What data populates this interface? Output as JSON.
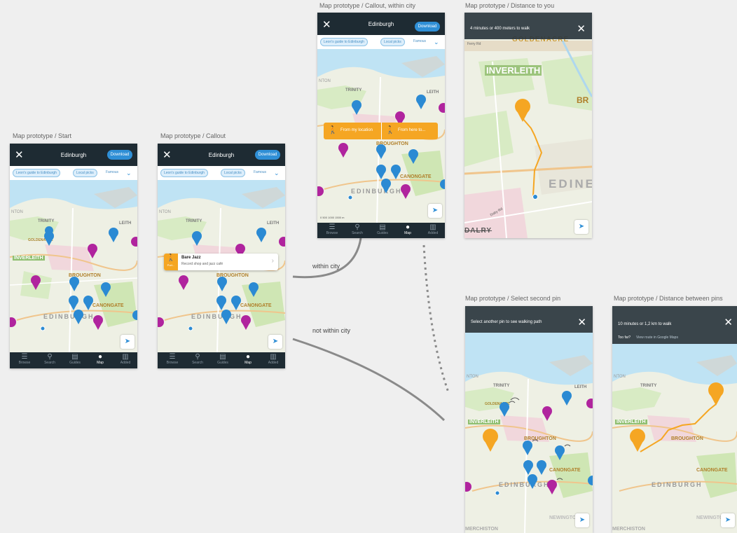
{
  "frames": {
    "start": {
      "label": "Map prototype / Start"
    },
    "callout": {
      "label": "Map prototype / Callout"
    },
    "callout_city": {
      "label": "Map prototype / Callout, within city"
    },
    "distance_you": {
      "label": "Map prototype / Distance to you"
    },
    "select_second": {
      "label": "Map prototype / Select second pin"
    },
    "distance_pins": {
      "label": "Map prototype / Distance between pins"
    }
  },
  "header": {
    "city": "Edinburgh",
    "download": "Download",
    "close": "✕"
  },
  "chips": [
    "Leon's guide to Edinburgh",
    "Local picks",
    "Famous"
  ],
  "nav": [
    "Browse",
    "Search",
    "Guides",
    "Map",
    "Added"
  ],
  "map_labels": {
    "trinity": "TRINITY",
    "leith": "LEITH",
    "goldenacre": "GOLDENACRE",
    "inverleith": "INVERLEITH",
    "broughton": "BROUGHTON",
    "canongate": "CANONGATE",
    "edinburgh": "EDINBURGH",
    "newington": "NEWINGTON",
    "dalry": "DALRY",
    "merchiston": "MERCHISTON",
    "ferry_rd": "Ferry Rd",
    "dalry_rd": "Dalry Rd",
    "edine": "EDINE",
    "scale": "0   500   1000   1500 m"
  },
  "callout": {
    "title": "Bare Jazz",
    "subtitle": "Record shop and jazz café",
    "badge": "Port..."
  },
  "city_callout": {
    "from_location": "From my location",
    "from_here": "From here to..."
  },
  "distance_you": {
    "text": "4 minutes or 400 meters to walk"
  },
  "select_second": {
    "text": "Select another pin to see walking path"
  },
  "distance_pins": {
    "text": "10 minutes or 1,2 km to walk",
    "too_far": "Too far?",
    "link": "View route in Google Maps"
  },
  "connectors": {
    "within": "within city",
    "not_within": "not within city"
  },
  "colors": {
    "blue_pin": "#2b8ad3",
    "magenta_pin": "#b0249e",
    "orange": "#f5a623",
    "dark": "#1e2b33"
  }
}
